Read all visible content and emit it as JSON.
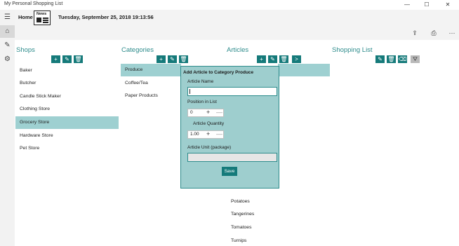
{
  "app": {
    "title": "My Personal Shopping List"
  },
  "window_controls": {
    "minimize": "—",
    "maximize": "☐",
    "close": "✕"
  },
  "rail": {
    "menu": "☰",
    "home": "⌂",
    "edit": "✎",
    "settings": "⚙"
  },
  "header": {
    "home_label": "Home",
    "logo_text": "News",
    "datetime": "Tuesday, September 25, 2018 19:13:56"
  },
  "toolbar": {
    "share": "⇪",
    "print": "⎙",
    "more": "···"
  },
  "columns": {
    "shops": {
      "title": "Shops",
      "buttons": [
        "+",
        "✎",
        "🗑"
      ],
      "items": [
        "Baker",
        "Butcher",
        "Candle Stick Maker",
        "Clothing Store",
        "Grocery Store",
        "Hardware Store",
        "Pet Store"
      ],
      "selected": "Grocery Store"
    },
    "categories": {
      "title": "Categories",
      "buttons": [
        "+",
        "✎",
        "🗑"
      ],
      "items": [
        "Produce",
        "Coffee/Tea",
        "Paper Products"
      ],
      "selected": "Produce"
    },
    "articles": {
      "title": "Articles",
      "buttons": [
        "+",
        "✎",
        "🗑",
        ">"
      ],
      "items": [
        "Potatoes",
        "Tangerines",
        "Tomatoes",
        "Turnips"
      ]
    },
    "shopping_list": {
      "title": "Shopping List",
      "buttons": [
        "✎",
        "🗑",
        "⌫",
        "⛛"
      ]
    }
  },
  "popup": {
    "title": "Add Article to Category Produce",
    "article_name_label": "Article Name",
    "article_name_value": "",
    "position_label": "Position in List",
    "position_value": "0",
    "quantity_label": "Article Quantity",
    "quantity_value": "1.00",
    "unit_label": "Article Unit (package)",
    "unit_value": "",
    "plus": "+",
    "minus": "—",
    "save_label": "Save"
  }
}
